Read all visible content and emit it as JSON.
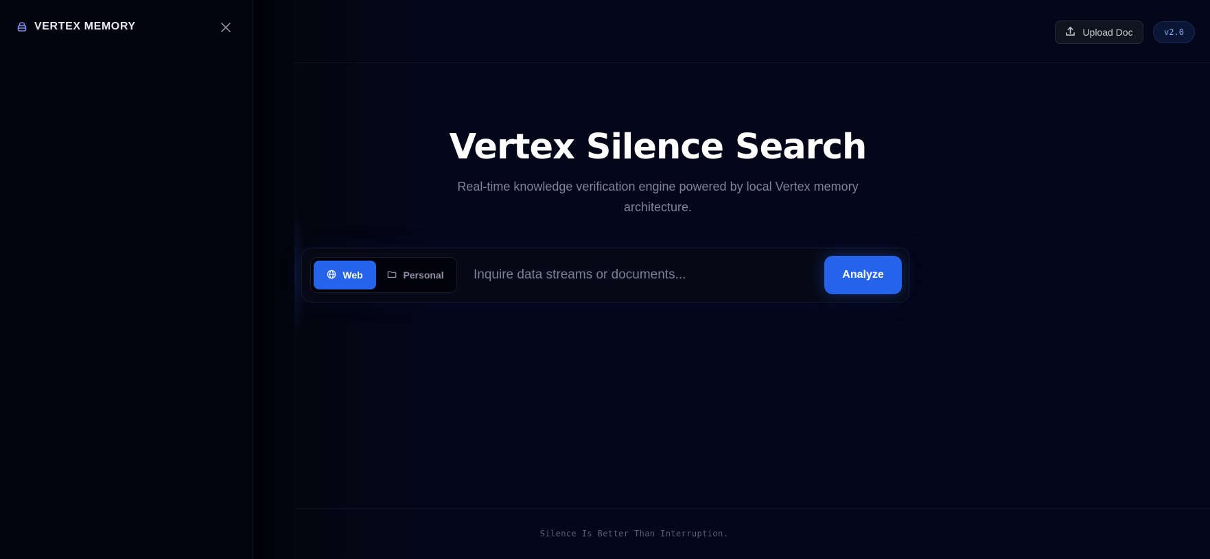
{
  "sidebar": {
    "title": "VERTEX MEMORY",
    "icons": {
      "brand": "database-icon",
      "close": "close-icon"
    }
  },
  "header": {
    "upload_label": "Upload Doc",
    "version": "v2.0"
  },
  "hero": {
    "title": "Vertex Silence Search",
    "subtitle": "Real-time knowledge verification engine powered by local Vertex memory architecture."
  },
  "search": {
    "modes": [
      {
        "label": "Web",
        "icon": "globe-icon",
        "active": true
      },
      {
        "label": "Personal",
        "icon": "folder-icon",
        "active": false
      }
    ],
    "placeholder": "Inquire data streams or documents...",
    "value": "",
    "submit_label": "Analyze"
  },
  "footer": {
    "text": "Silence Is Better Than Interruption."
  },
  "colors": {
    "accent": "#2563eb",
    "background": "#04061a",
    "sidebar": "#02040d"
  }
}
